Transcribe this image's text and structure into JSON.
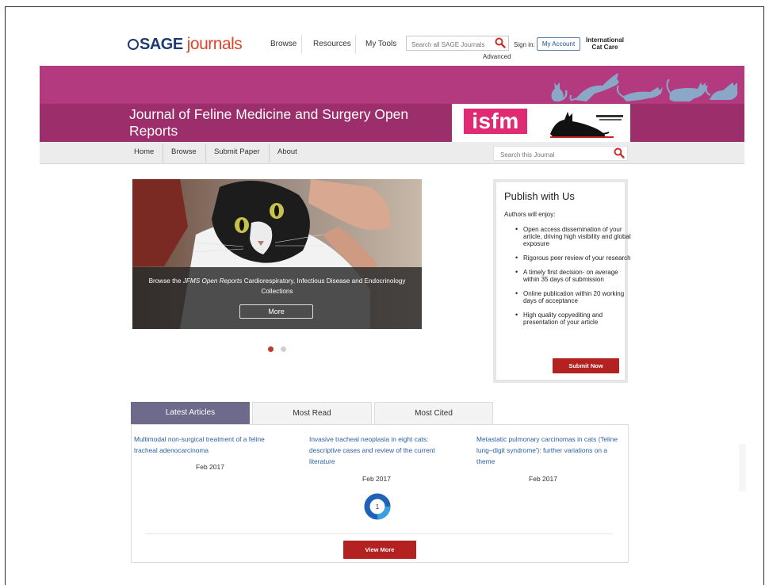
{
  "colors": {
    "banner_top": "#b33a7e",
    "banner_bottom": "#9b2e6b",
    "accent_red": "#b32121",
    "tab_active": "#6d6a8c",
    "link_blue": "#2a5fa8",
    "isfm_pink": "#e02a74"
  },
  "header": {
    "logo": {
      "brand": "SAGE",
      "product": "journals"
    },
    "nav": [
      "Browse",
      "Resources",
      "My Tools"
    ],
    "search_placeholder": "Search all SAGE Journals",
    "advanced_label": "Advanced",
    "sign_in_label": "Sign in:",
    "my_account_label": "My Account",
    "partner": {
      "line1": "International",
      "line2": "Cat Care"
    }
  },
  "journal": {
    "title_line1": "Journal of Feline Medicine and Surgery Open",
    "title_line2": "Reports",
    "society_logo_text": "isfm",
    "nav": [
      "Home",
      "Browse",
      "Submit Paper",
      "About"
    ],
    "search_placeholder": "Search this Journal"
  },
  "carousel": {
    "caption_prefix": "Browse the ",
    "caption_italic": "JFMS Open Reports",
    "caption_suffix": " Cardiorespiratory, Infectious Disease and Endocrinology Collections",
    "button_label": "More",
    "active_slide": 1,
    "slide_count": 2
  },
  "publish": {
    "title": "Publish with Us",
    "intro": "Authors will enjoy:",
    "benefits": [
      "Open access dissemination of your article, driving high visibility and global exposure",
      "Rigorous peer review of your research",
      "A timely first decision- on average within 35 days of submission",
      "Online publication within 20 working days of acceptance",
      "High quality copyediting and presentation of your article"
    ],
    "button_label": "Submit Now"
  },
  "tabs": [
    "Latest Articles",
    "Most Read",
    "Most Cited"
  ],
  "active_tab": "Latest Articles",
  "articles": [
    {
      "title": "Multimodal non-surgical treatment of a feline tracheal adenocarcinoma",
      "date": "Feb 2017"
    },
    {
      "title": "Invasive tracheal neoplasia in eight cats: descriptive cases and review of the current literature",
      "date": "Feb 2017",
      "metric": "1"
    },
    {
      "title": "Metastatic pulmonary carcinomas in cats ('feline lung–digit syndrome'): further variations on a theme",
      "date": "Feb 2017"
    }
  ],
  "view_more_label": "View More"
}
